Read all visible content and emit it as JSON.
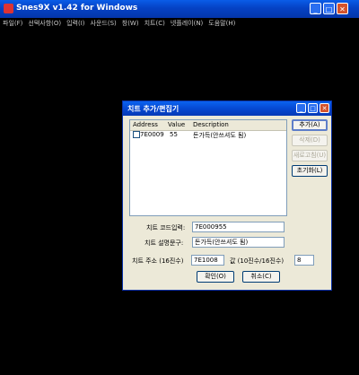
{
  "app": {
    "title": "Snes9X v1.42 for Windows"
  },
  "menu": [
    "파일(F)",
    "선택사항(O)",
    "입력(I)",
    "사운드(S)",
    "창(W)",
    "치트(C)",
    "넷플레이(N)",
    "도움말(H)"
  ],
  "dialog": {
    "title": "치트 추가/편집기",
    "columns": [
      "Address",
      "Value",
      "Description"
    ],
    "rows": [
      {
        "address": "7E0009",
        "value": "55",
        "description": "돈가득(안쓰셔도 됨)"
      }
    ],
    "buttons": {
      "add": "추가(A)",
      "delete": "삭제(D)",
      "update": "새로고침(U)",
      "reset": "초기화(L)",
      "ok": "확인(O)",
      "cancel": "취소(C)"
    },
    "fields": {
      "code_label": "치트 코드입력:",
      "code_value": "7E000955",
      "desc_label": "치트 설명문구:",
      "desc_value": "돈가득(안쓰셔도 됨)",
      "addr_label": "치트 주소 (16진수)",
      "addr_value": "7E1008",
      "val_label": "값 (10진수/16진수)",
      "val_value": "8"
    }
  }
}
